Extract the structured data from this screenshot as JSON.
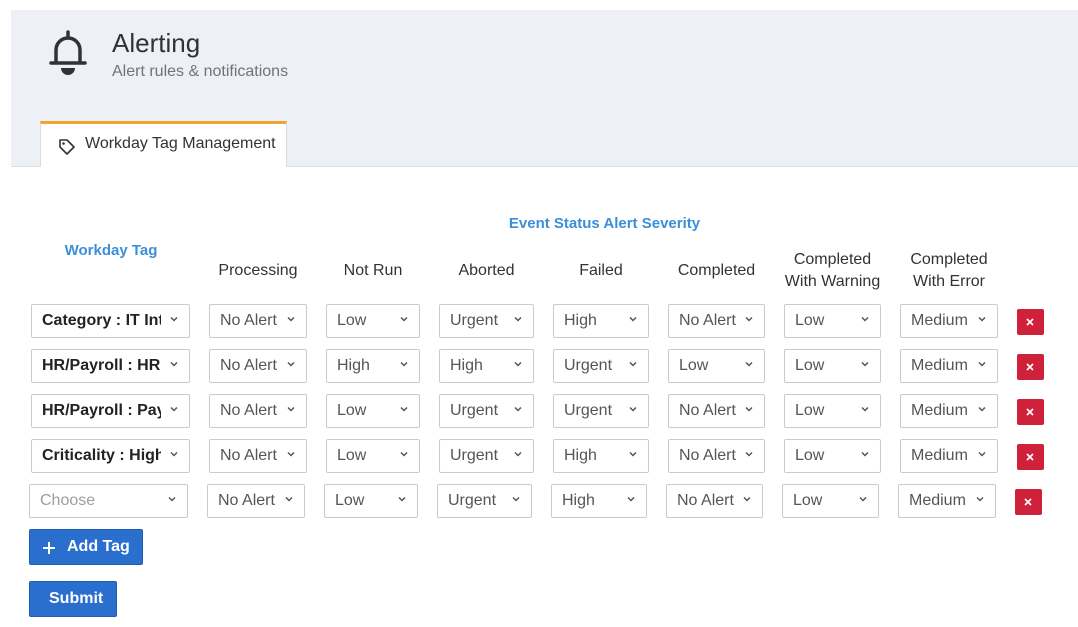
{
  "page": {
    "title": "Alerting",
    "subtitle": "Alert rules & notifications",
    "icon": "bell-icon"
  },
  "tabs": [
    {
      "label": "Workday Tag Management",
      "icon": "tag-icon",
      "active": true
    }
  ],
  "table": {
    "group_header": "Event Status Alert Severity",
    "tag_header": "Workday Tag",
    "columns": [
      [
        "Processing"
      ],
      [
        "Not Run"
      ],
      [
        "Aborted"
      ],
      [
        "Failed"
      ],
      [
        "Completed"
      ],
      [
        "Completed",
        "With Warning"
      ],
      [
        "Completed",
        "With Error"
      ]
    ],
    "rows": [
      {
        "tag": "Category : IT Inte",
        "values": [
          "No Alert",
          "Low",
          "Urgent",
          "High",
          "No Alert",
          "Low",
          "Medium"
        ]
      },
      {
        "tag": "HR/Payroll : HR",
        "values": [
          "No Alert",
          "High",
          "High",
          "Urgent",
          "Low",
          "Low",
          "Medium"
        ]
      },
      {
        "tag": "HR/Payroll : Payr",
        "values": [
          "No Alert",
          "Low",
          "Urgent",
          "Urgent",
          "No Alert",
          "Low",
          "Medium"
        ]
      },
      {
        "tag": "Criticality : High",
        "values": [
          "No Alert",
          "Low",
          "Urgent",
          "High",
          "No Alert",
          "Low",
          "Medium"
        ]
      },
      {
        "tag": "",
        "tag_placeholder": "Choose",
        "values": [
          "No Alert",
          "Low",
          "Urgent",
          "High",
          "No Alert",
          "Low",
          "Medium"
        ]
      }
    ]
  },
  "buttons": {
    "add_tag": "Add Tag",
    "submit": "Submit"
  },
  "colors": {
    "accent": "#2a6fce",
    "header_blue": "#3b8fd9",
    "delete": "#d0213a",
    "tab_top": "#f0a32e"
  }
}
